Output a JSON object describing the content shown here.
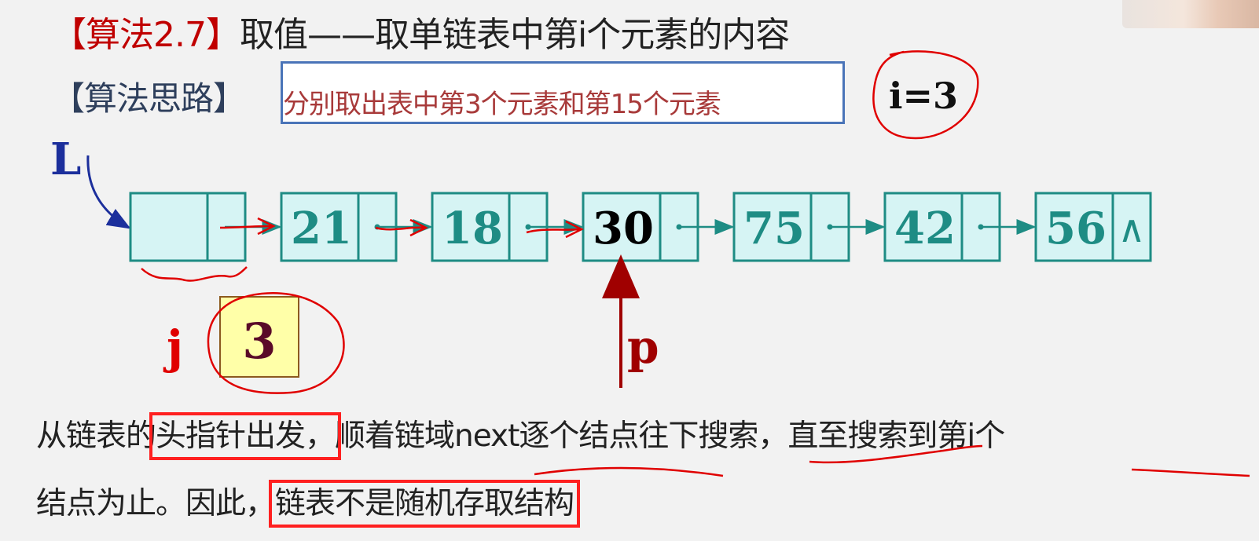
{
  "slide": {
    "title_alg": "【算法2.7】",
    "title_rest": "取值——取单链表中第i个元素的内容",
    "idea_label": "【算法思路】",
    "task_text": "分别取出表中第3个元素和第15个元素",
    "i_note": "i=3"
  },
  "diagram": {
    "head_label": "L",
    "nodes": [
      "21",
      "18",
      "30",
      "75",
      "42",
      "56"
    ],
    "current_node_index": 2,
    "null_symbol": "∧",
    "j_label": "j",
    "j_value": "3",
    "p_label": "p"
  },
  "paragraph": {
    "l1_a": "从链表的",
    "l1_hl": "头指针出发，",
    "l1_b": "顺着链域next逐个结点往下搜索，直至搜索到第i个",
    "l2_a": "结点为止。因此，",
    "l2_hl": "链表不是随机存取结构"
  },
  "colors": {
    "node_fill": "#d6f4f4",
    "node_border": "#1e8c84",
    "node_text": "#1e8c84",
    "current_text": "#000000",
    "pointer_arrow": "#1e8c84",
    "annotation_red": "#e00000",
    "p_arrow": "#a00000",
    "j_box_fill": "#ffffa8",
    "head_label": "#1c2f9c"
  }
}
